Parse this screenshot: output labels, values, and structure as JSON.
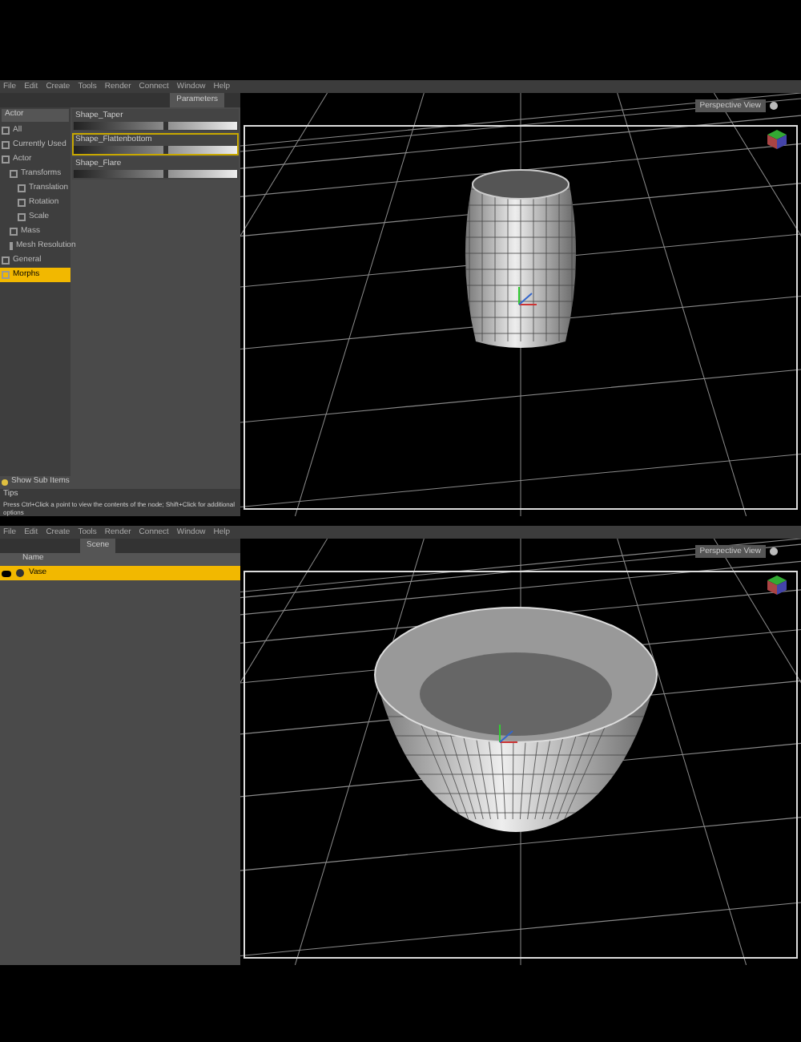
{
  "screens": [
    {
      "menu": [
        "File",
        "Edit",
        "Create",
        "Tools",
        "Render",
        "Connect",
        "Window",
        "Help"
      ],
      "tab": {
        "label": "Parameters"
      },
      "filter": {
        "value": "Actor"
      },
      "tree": [
        {
          "label": "All",
          "selected": false
        },
        {
          "label": "Currently Used",
          "selected": false
        },
        {
          "label": "Actor",
          "selected": false,
          "children": [
            {
              "label": "Transforms",
              "selected": false,
              "children": [
                {
                  "label": "Translation",
                  "selected": false
                },
                {
                  "label": "Rotation",
                  "selected": false
                },
                {
                  "label": "Scale",
                  "selected": false
                }
              ]
            },
            {
              "label": "Mass",
              "selected": false
            },
            {
              "label": "Mesh Resolution",
              "selected": false
            }
          ]
        },
        {
          "label": "General",
          "selected": false
        },
        {
          "label": "Morphs",
          "selected": true
        }
      ],
      "sliders": [
        {
          "label": "Shape_Taper",
          "level": 0.55,
          "selected": false
        },
        {
          "label": "Shape_Flattenbottom",
          "level": 0.55,
          "selected": true
        },
        {
          "label": "Shape_Flare",
          "level": 0.55,
          "selected": false
        }
      ],
      "footer": "Show Sub Items",
      "tips_title": "Tips",
      "tip": "Press Ctrl+Click a point to view the contents of the node; Shift+Click for additional options",
      "view": "Perspective View"
    },
    {
      "menu": [
        "File",
        "Edit",
        "Create",
        "Tools",
        "Render",
        "Connect",
        "Window",
        "Help"
      ],
      "tab": {
        "label": "Scene"
      },
      "header": "Name",
      "rows": [
        {
          "label": "Vase",
          "selected": true
        }
      ],
      "view": "Perspective View"
    }
  ]
}
